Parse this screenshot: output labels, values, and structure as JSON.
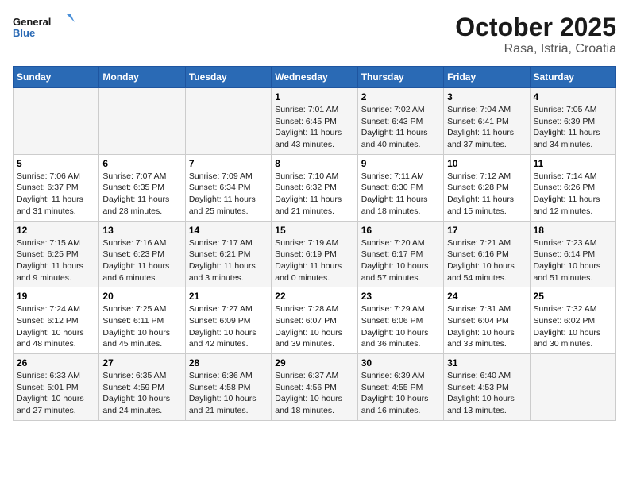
{
  "logo": {
    "line1": "General",
    "line2": "Blue"
  },
  "title": "October 2025",
  "subtitle": "Rasa, Istria, Croatia",
  "weekdays": [
    "Sunday",
    "Monday",
    "Tuesday",
    "Wednesday",
    "Thursday",
    "Friday",
    "Saturday"
  ],
  "weeks": [
    [
      {
        "day": "",
        "info": ""
      },
      {
        "day": "",
        "info": ""
      },
      {
        "day": "",
        "info": ""
      },
      {
        "day": "1",
        "info": "Sunrise: 7:01 AM\nSunset: 6:45 PM\nDaylight: 11 hours\nand 43 minutes."
      },
      {
        "day": "2",
        "info": "Sunrise: 7:02 AM\nSunset: 6:43 PM\nDaylight: 11 hours\nand 40 minutes."
      },
      {
        "day": "3",
        "info": "Sunrise: 7:04 AM\nSunset: 6:41 PM\nDaylight: 11 hours\nand 37 minutes."
      },
      {
        "day": "4",
        "info": "Sunrise: 7:05 AM\nSunset: 6:39 PM\nDaylight: 11 hours\nand 34 minutes."
      }
    ],
    [
      {
        "day": "5",
        "info": "Sunrise: 7:06 AM\nSunset: 6:37 PM\nDaylight: 11 hours\nand 31 minutes."
      },
      {
        "day": "6",
        "info": "Sunrise: 7:07 AM\nSunset: 6:35 PM\nDaylight: 11 hours\nand 28 minutes."
      },
      {
        "day": "7",
        "info": "Sunrise: 7:09 AM\nSunset: 6:34 PM\nDaylight: 11 hours\nand 25 minutes."
      },
      {
        "day": "8",
        "info": "Sunrise: 7:10 AM\nSunset: 6:32 PM\nDaylight: 11 hours\nand 21 minutes."
      },
      {
        "day": "9",
        "info": "Sunrise: 7:11 AM\nSunset: 6:30 PM\nDaylight: 11 hours\nand 18 minutes."
      },
      {
        "day": "10",
        "info": "Sunrise: 7:12 AM\nSunset: 6:28 PM\nDaylight: 11 hours\nand 15 minutes."
      },
      {
        "day": "11",
        "info": "Sunrise: 7:14 AM\nSunset: 6:26 PM\nDaylight: 11 hours\nand 12 minutes."
      }
    ],
    [
      {
        "day": "12",
        "info": "Sunrise: 7:15 AM\nSunset: 6:25 PM\nDaylight: 11 hours\nand 9 minutes."
      },
      {
        "day": "13",
        "info": "Sunrise: 7:16 AM\nSunset: 6:23 PM\nDaylight: 11 hours\nand 6 minutes."
      },
      {
        "day": "14",
        "info": "Sunrise: 7:17 AM\nSunset: 6:21 PM\nDaylight: 11 hours\nand 3 minutes."
      },
      {
        "day": "15",
        "info": "Sunrise: 7:19 AM\nSunset: 6:19 PM\nDaylight: 11 hours\nand 0 minutes."
      },
      {
        "day": "16",
        "info": "Sunrise: 7:20 AM\nSunset: 6:17 PM\nDaylight: 10 hours\nand 57 minutes."
      },
      {
        "day": "17",
        "info": "Sunrise: 7:21 AM\nSunset: 6:16 PM\nDaylight: 10 hours\nand 54 minutes."
      },
      {
        "day": "18",
        "info": "Sunrise: 7:23 AM\nSunset: 6:14 PM\nDaylight: 10 hours\nand 51 minutes."
      }
    ],
    [
      {
        "day": "19",
        "info": "Sunrise: 7:24 AM\nSunset: 6:12 PM\nDaylight: 10 hours\nand 48 minutes."
      },
      {
        "day": "20",
        "info": "Sunrise: 7:25 AM\nSunset: 6:11 PM\nDaylight: 10 hours\nand 45 minutes."
      },
      {
        "day": "21",
        "info": "Sunrise: 7:27 AM\nSunset: 6:09 PM\nDaylight: 10 hours\nand 42 minutes."
      },
      {
        "day": "22",
        "info": "Sunrise: 7:28 AM\nSunset: 6:07 PM\nDaylight: 10 hours\nand 39 minutes."
      },
      {
        "day": "23",
        "info": "Sunrise: 7:29 AM\nSunset: 6:06 PM\nDaylight: 10 hours\nand 36 minutes."
      },
      {
        "day": "24",
        "info": "Sunrise: 7:31 AM\nSunset: 6:04 PM\nDaylight: 10 hours\nand 33 minutes."
      },
      {
        "day": "25",
        "info": "Sunrise: 7:32 AM\nSunset: 6:02 PM\nDaylight: 10 hours\nand 30 minutes."
      }
    ],
    [
      {
        "day": "26",
        "info": "Sunrise: 6:33 AM\nSunset: 5:01 PM\nDaylight: 10 hours\nand 27 minutes."
      },
      {
        "day": "27",
        "info": "Sunrise: 6:35 AM\nSunset: 4:59 PM\nDaylight: 10 hours\nand 24 minutes."
      },
      {
        "day": "28",
        "info": "Sunrise: 6:36 AM\nSunset: 4:58 PM\nDaylight: 10 hours\nand 21 minutes."
      },
      {
        "day": "29",
        "info": "Sunrise: 6:37 AM\nSunset: 4:56 PM\nDaylight: 10 hours\nand 18 minutes."
      },
      {
        "day": "30",
        "info": "Sunrise: 6:39 AM\nSunset: 4:55 PM\nDaylight: 10 hours\nand 16 minutes."
      },
      {
        "day": "31",
        "info": "Sunrise: 6:40 AM\nSunset: 4:53 PM\nDaylight: 10 hours\nand 13 minutes."
      },
      {
        "day": "",
        "info": ""
      }
    ]
  ]
}
